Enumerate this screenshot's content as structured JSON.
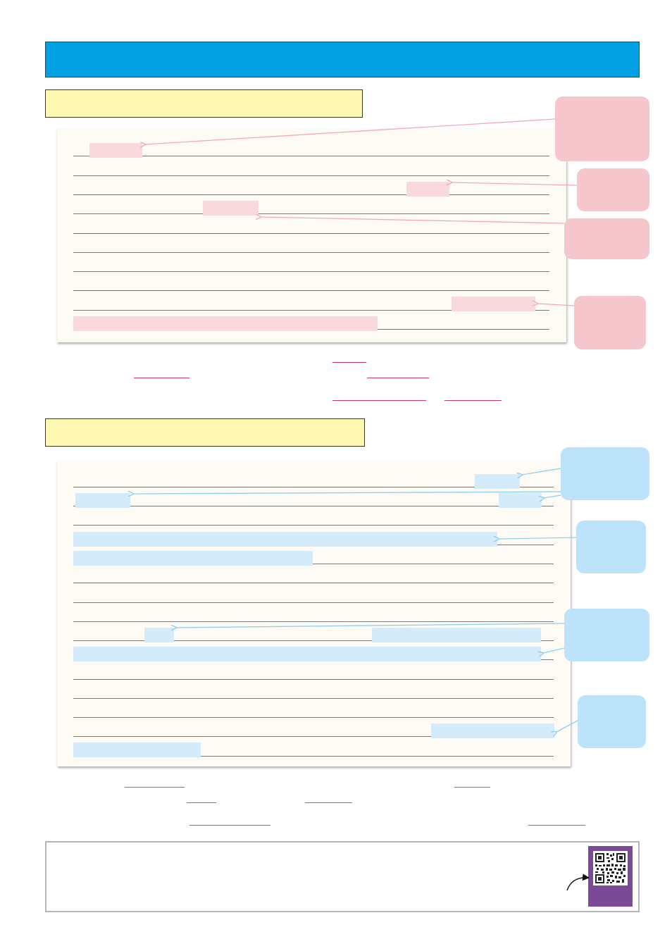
{
  "page": {
    "title_bar": {
      "text": ""
    },
    "task_one": {
      "label": ""
    },
    "task_two": {
      "label": ""
    },
    "footer": {
      "text": ""
    }
  },
  "colors": {
    "title_bar": "#00a0e2",
    "task_box": "#fff8b3",
    "paper": "#fdfbf4",
    "pink_highlight": "#f9d9de",
    "pink_callout": "#f6c6cd",
    "pink_arrow": "#f4a8b6",
    "pink_blank": "#d6336a",
    "blue_highlight": "#d3ebfb",
    "blue_callout": "#bde3fa",
    "blue_arrow": "#8fcff2",
    "blue_blank": "#2d8fe0",
    "qr_card": "#7a4a96"
  },
  "icons": {
    "qr": "qr-code-icon",
    "pointer": "curved-arrow-icon"
  }
}
